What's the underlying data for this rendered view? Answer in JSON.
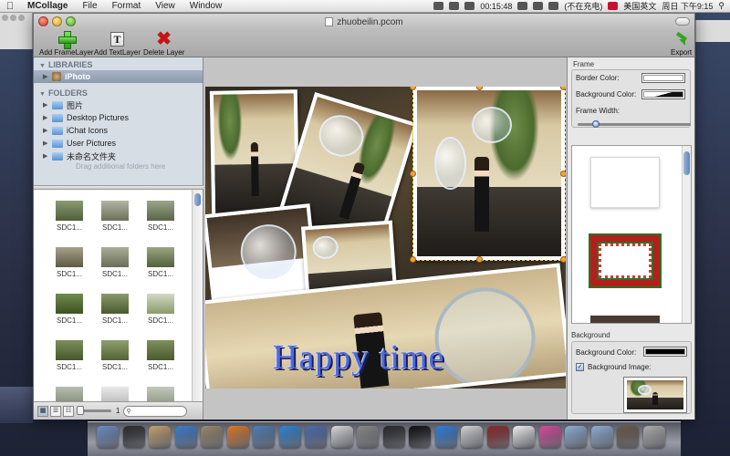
{
  "menubar": {
    "app_name": "MCollage",
    "items": [
      "File",
      "Format",
      "View",
      "Window"
    ],
    "clock_timer": "00:15:48",
    "charging": "(不在充电)",
    "input_source": "美国英文",
    "datetime": "周日 下午9:15"
  },
  "window": {
    "title": "zhuobeilin.pcom"
  },
  "toolbar": {
    "add_frame_layer": "Add FrameLayer",
    "add_text_layer": "Add TextLayer",
    "delete_layer": "Delete Layer",
    "export": "Export"
  },
  "sidebar": {
    "libraries_header": "LIBRARIES",
    "iphoto": "iPhoto",
    "folders_header": "FOLDERS",
    "folders": [
      "图片",
      "Desktop Pictures",
      "iChat Icons",
      "User Pictures",
      "未命名文件夹"
    ],
    "drag_hint": "Drag additional folders here"
  },
  "thumbnails": {
    "items": [
      "SDC1...",
      "SDC1...",
      "SDC1...",
      "SDC1...",
      "SDC1...",
      "SDC1...",
      "SDC1...",
      "SDC1...",
      "SDC1...",
      "SDC1...",
      "SDC1...",
      "SDC1...",
      "",
      "",
      ""
    ],
    "zoom_value": "1",
    "search_placeholder": ""
  },
  "canvas": {
    "text_layer": "Happy  time"
  },
  "inspector": {
    "frame_section": "Frame",
    "border_color_label": "Border Color:",
    "background_color_label": "Background Color:",
    "frame_width_label": "Frame Width:",
    "background_section": "Background",
    "bg_color_label": "Background Color:",
    "bg_image_label": "Background Image:",
    "bg_image_checked": true
  },
  "colors": {
    "selection_blue": "#8c9aae",
    "handle_orange": "#f0a43a",
    "text_layer_blue": "#4d6ad8",
    "delete_red": "#c41414",
    "add_green": "#2a9a1c"
  },
  "dock": {
    "icons": [
      "finder-icon",
      "dashboard-icon",
      "address-book-icon",
      "safari-icon",
      "preview-icon",
      "firefox-icon",
      "iphoto-icon",
      "itunes-icon",
      "xcode-icon",
      "textedit-icon",
      "system-preferences-icon",
      "activity-monitor-icon",
      "terminal-icon",
      "app-store-icon",
      "ical-icon",
      "dictionary-icon",
      "calendar-icon",
      "photo-booth-icon",
      "documents-folder-icon",
      "downloads-folder-icon",
      "photos-stack-icon",
      "trash-icon"
    ]
  }
}
